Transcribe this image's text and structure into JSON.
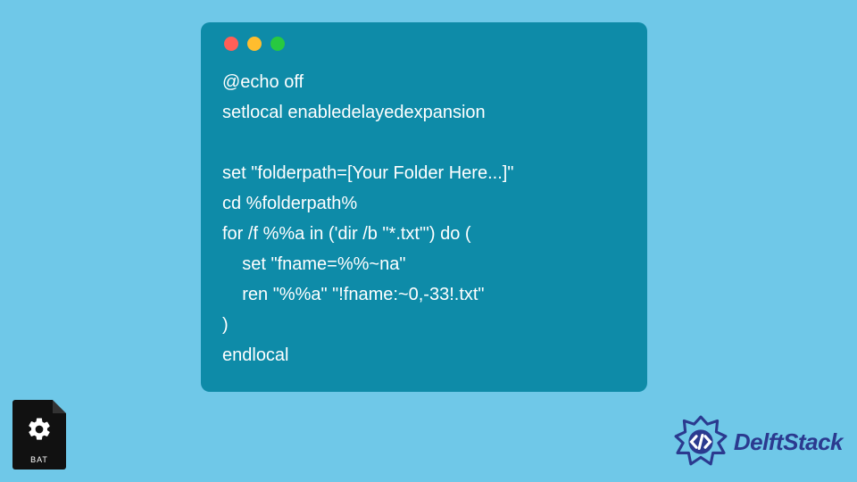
{
  "code": {
    "lines": [
      "@echo off",
      "setlocal enabledelayedexpansion",
      "",
      "set \"folderpath=[Your Folder Here...]\"",
      "cd %folderpath%",
      "for /f %%a in ('dir /b \"*.txt\"') do (",
      "    set \"fname=%%~na\"",
      "    ren \"%%a\" \"!fname:~0,-33!.txt\"",
      ")",
      "endlocal"
    ]
  },
  "bat_icon": {
    "label": "BAT"
  },
  "brand": {
    "name": "DelftStack"
  },
  "colors": {
    "page_bg": "#6fc8e8",
    "window_bg": "#0e8ba8",
    "code_fg": "#ffffff",
    "brand_fg": "#2b3a8f",
    "dot_red": "#ff5f57",
    "dot_yellow": "#ffbd2e",
    "dot_green": "#28c940"
  }
}
